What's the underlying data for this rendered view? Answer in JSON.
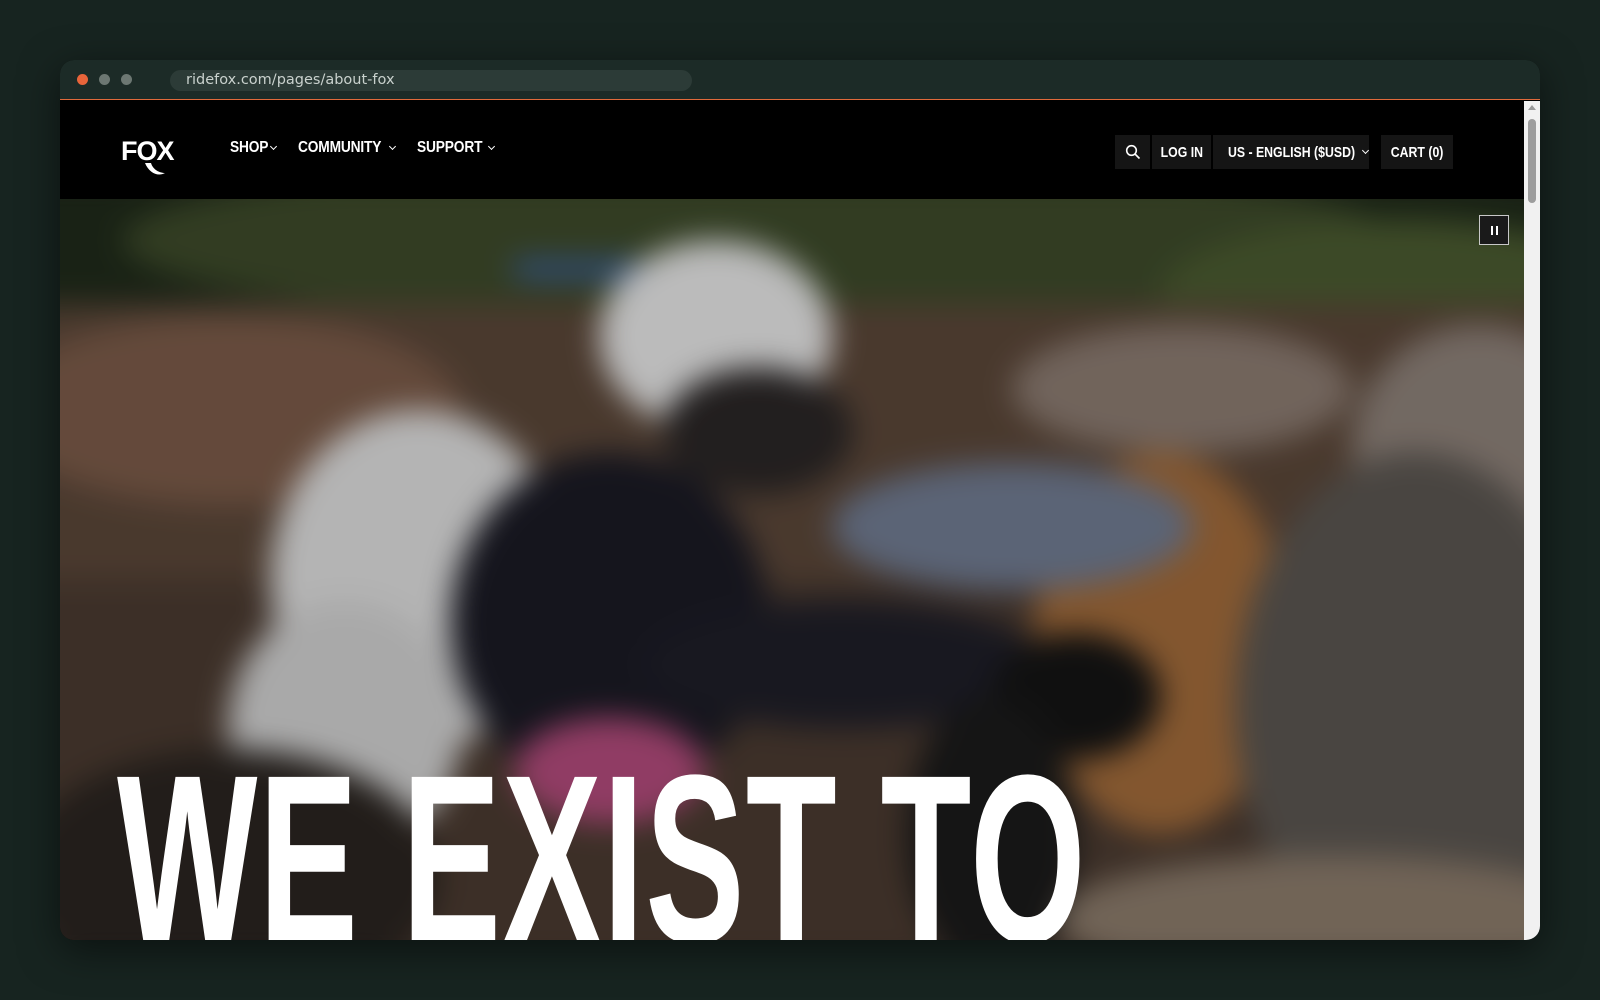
{
  "browser": {
    "url": "ridefox.com/pages/about-fox"
  },
  "header": {
    "logo_text": "FOX",
    "nav": [
      {
        "label": "SHOP"
      },
      {
        "label": "COMMUNITY"
      },
      {
        "label": "SUPPORT"
      }
    ],
    "login_label": "LOG IN",
    "locale_label": "US - ENGLISH ($USD)",
    "cart_label": "CART (0)"
  },
  "hero": {
    "headline": "WE EXIST TO",
    "pause_icon": "pause-icon"
  },
  "colors": {
    "window_accent": "#e06a3b",
    "header_bg": "#000000",
    "page_bg": "#172420"
  }
}
